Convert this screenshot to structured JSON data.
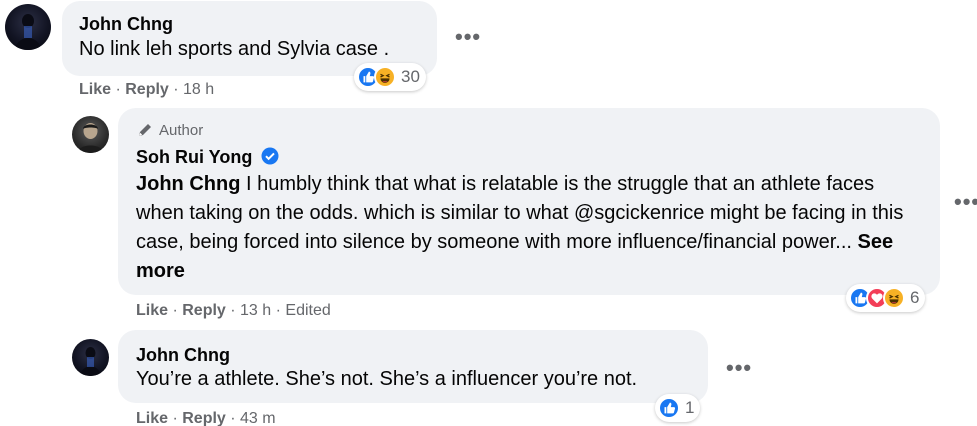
{
  "comments": [
    {
      "author": "John Chng",
      "text": "No link leh sports and Sylvia case .",
      "reactions": {
        "icons": [
          "like-icon",
          "haha-icon"
        ],
        "count": "30"
      },
      "actions": {
        "like": "Like",
        "reply": "Reply",
        "time": "18 h"
      }
    },
    {
      "badge": "Author",
      "author": "Soh Rui Yong",
      "mention": "John Chng",
      "text": " I humbly think that what is relatable is the struggle that an athlete faces when taking on the odds. which is similar to what @sgcickenrice might be facing in this case, being forced into silence by someone with more influence/financial power... ",
      "see_more": "See more",
      "reactions": {
        "icons": [
          "like-icon",
          "love-icon",
          "haha-icon"
        ],
        "count": "6"
      },
      "actions": {
        "like": "Like",
        "reply": "Reply",
        "time": "13 h",
        "edited": "Edited"
      }
    },
    {
      "author": "John Chng",
      "text": "You’re a athlete. She’s not. She’s a influencer you’re not.",
      "reactions": {
        "icons": [
          "like-icon"
        ],
        "count": "1"
      },
      "actions": {
        "like": "Like",
        "reply": "Reply",
        "time": "43 m"
      }
    }
  ],
  "more_glyph": "•••",
  "separator": " · ",
  "colors": {
    "bubble": "#f0f2f5",
    "like_blue": "#1877f2",
    "love_red": "#f33e58",
    "haha_yellow": "#f7b125",
    "meta_gray": "#65676b"
  }
}
